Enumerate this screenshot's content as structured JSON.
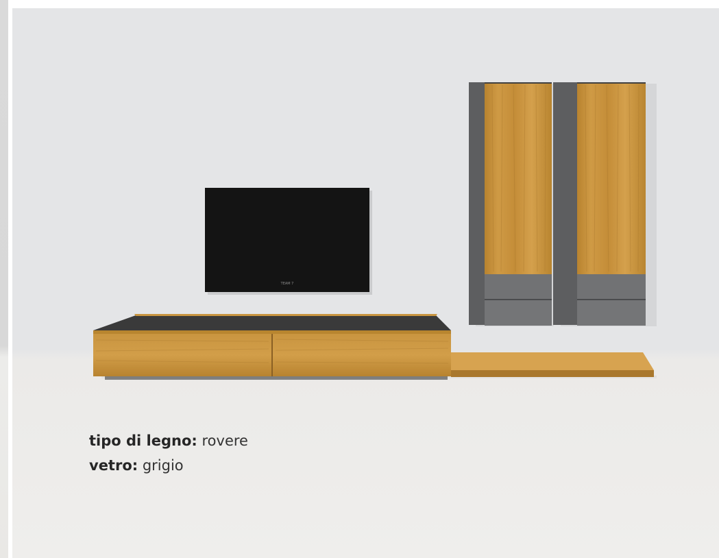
{
  "caption": {
    "wood_type": {
      "label": "tipo di legno:",
      "value": "rovere"
    },
    "glass": {
      "label": "vetro:",
      "value": "grigio"
    }
  },
  "tv": {
    "brand": "TEAM 7"
  },
  "colors": {
    "wall": "#e4e5e7",
    "floor": "#efeeec",
    "oak": "#c6923c",
    "anthracite": "#6e6e6e",
    "screen": "#141414"
  }
}
